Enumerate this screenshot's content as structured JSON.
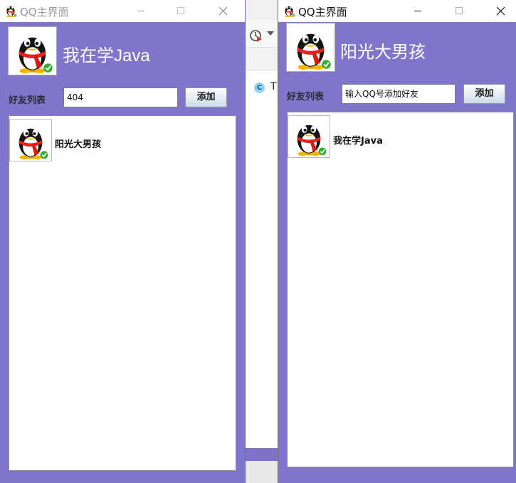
{
  "background_window": {
    "tab_letter": "T",
    "icons": [
      "history-clock-icon",
      "dropdown-caret-icon",
      "site-favicon-icon"
    ]
  },
  "windows": [
    {
      "title": "QQ主界面",
      "state": "inactive",
      "user": {
        "nickname": "我在学Java",
        "avatar": "qq-penguin-icon"
      },
      "friend_list_label": "好友列表",
      "add_input": {
        "value": "404",
        "placeholder": "输入QQ号添加好友"
      },
      "add_button": "添加",
      "friends": [
        {
          "name": "阳光大男孩",
          "avatar": "qq-penguin-icon"
        }
      ]
    },
    {
      "title": "QQ主界面",
      "state": "active",
      "user": {
        "nickname": "阳光大男孩",
        "avatar": "qq-penguin-icon"
      },
      "friend_list_label": "好友列表",
      "add_input": {
        "value": "",
        "placeholder": "输入QQ号添加好友"
      },
      "add_button": "添加",
      "friends": [
        {
          "name": "我在学Java",
          "avatar": "qq-penguin-icon"
        }
      ]
    }
  ],
  "colors": {
    "window_bg": "#7f76cc",
    "panel_bg": "#ffffff",
    "nickname_text": "#ffffff"
  }
}
